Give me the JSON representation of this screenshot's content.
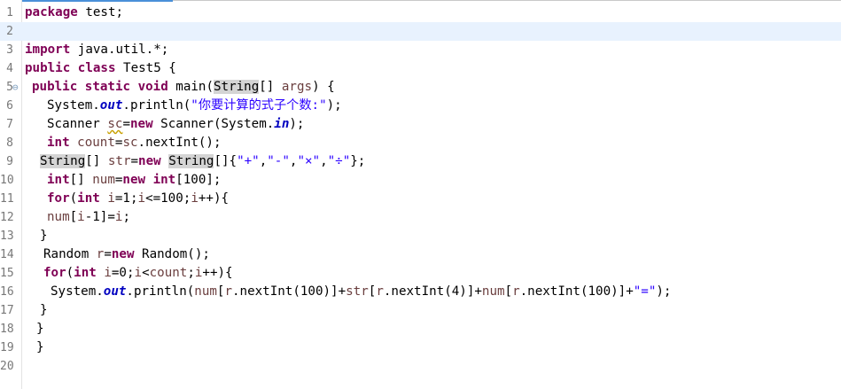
{
  "editor": {
    "current_line": 2,
    "lines": [
      {
        "n": "1",
        "fold": false,
        "indent": 0,
        "tokens": [
          {
            "t": "package",
            "c": "kw"
          },
          {
            "t": " test;",
            "c": ""
          }
        ]
      },
      {
        "n": "2",
        "fold": false,
        "indent": 0,
        "tokens": []
      },
      {
        "n": "3",
        "fold": false,
        "indent": 0,
        "tokens": [
          {
            "t": "import",
            "c": "kw"
          },
          {
            "t": " java.util.*;",
            "c": ""
          }
        ]
      },
      {
        "n": "4",
        "fold": false,
        "indent": 0,
        "tokens": [
          {
            "t": "public",
            "c": "kw"
          },
          {
            "t": " ",
            "c": ""
          },
          {
            "t": "class",
            "c": "kw"
          },
          {
            "t": " Test5 {",
            "c": ""
          }
        ]
      },
      {
        "n": "5",
        "fold": true,
        "indent": 2,
        "tokens": [
          {
            "t": "public",
            "c": "kw"
          },
          {
            "t": " ",
            "c": ""
          },
          {
            "t": "static",
            "c": "kw"
          },
          {
            "t": " ",
            "c": ""
          },
          {
            "t": "void",
            "c": "kw"
          },
          {
            "t": " main(",
            "c": ""
          },
          {
            "t": "String",
            "c": "hl"
          },
          {
            "t": "[] ",
            "c": ""
          },
          {
            "t": "args",
            "c": "var"
          },
          {
            "t": ") {",
            "c": ""
          }
        ]
      },
      {
        "n": "6",
        "fold": false,
        "indent": 6,
        "tokens": [
          {
            "t": "System.",
            "c": ""
          },
          {
            "t": "out",
            "c": "fld"
          },
          {
            "t": ".println(",
            "c": ""
          },
          {
            "t": "\"你要计算的式子个数:\"",
            "c": "str"
          },
          {
            "t": ");",
            "c": ""
          }
        ]
      },
      {
        "n": "7",
        "fold": false,
        "indent": 6,
        "tokens": [
          {
            "t": "Scanner ",
            "c": ""
          },
          {
            "t": "sc",
            "c": "var warn"
          },
          {
            "t": "=",
            "c": ""
          },
          {
            "t": "new",
            "c": "kw"
          },
          {
            "t": " Scanner(System.",
            "c": ""
          },
          {
            "t": "in",
            "c": "fld"
          },
          {
            "t": ");",
            "c": ""
          }
        ]
      },
      {
        "n": "8",
        "fold": false,
        "indent": 6,
        "tokens": [
          {
            "t": "int",
            "c": "kw"
          },
          {
            "t": " ",
            "c": ""
          },
          {
            "t": "count",
            "c": "var"
          },
          {
            "t": "=",
            "c": ""
          },
          {
            "t": "sc",
            "c": "var"
          },
          {
            "t": ".nextInt();",
            "c": ""
          }
        ]
      },
      {
        "n": "9",
        "fold": false,
        "indent": 4,
        "tokens": [
          {
            "t": "String",
            "c": "hl"
          },
          {
            "t": "[] ",
            "c": ""
          },
          {
            "t": "str",
            "c": "var"
          },
          {
            "t": "=",
            "c": ""
          },
          {
            "t": "new",
            "c": "kw"
          },
          {
            "t": " ",
            "c": ""
          },
          {
            "t": "String",
            "c": "hl"
          },
          {
            "t": "[]{",
            "c": ""
          },
          {
            "t": "\"+\"",
            "c": "str"
          },
          {
            "t": ",",
            "c": ""
          },
          {
            "t": "\"-\"",
            "c": "str"
          },
          {
            "t": ",",
            "c": ""
          },
          {
            "t": "\"×\"",
            "c": "str"
          },
          {
            "t": ",",
            "c": ""
          },
          {
            "t": "\"÷\"",
            "c": "str"
          },
          {
            "t": "};",
            "c": ""
          }
        ]
      },
      {
        "n": "10",
        "fold": false,
        "indent": 6,
        "tokens": [
          {
            "t": "int",
            "c": "kw"
          },
          {
            "t": "[] ",
            "c": ""
          },
          {
            "t": "num",
            "c": "var"
          },
          {
            "t": "=",
            "c": ""
          },
          {
            "t": "new",
            "c": "kw"
          },
          {
            "t": " ",
            "c": ""
          },
          {
            "t": "int",
            "c": "kw"
          },
          {
            "t": "[100];",
            "c": ""
          }
        ]
      },
      {
        "n": "11",
        "fold": false,
        "indent": 6,
        "tokens": [
          {
            "t": "for",
            "c": "kw"
          },
          {
            "t": "(",
            "c": ""
          },
          {
            "t": "int",
            "c": "kw"
          },
          {
            "t": " ",
            "c": ""
          },
          {
            "t": "i",
            "c": "var"
          },
          {
            "t": "=1;",
            "c": ""
          },
          {
            "t": "i",
            "c": "var"
          },
          {
            "t": "<=100;",
            "c": ""
          },
          {
            "t": "i",
            "c": "var"
          },
          {
            "t": "++){",
            "c": ""
          }
        ]
      },
      {
        "n": "12",
        "fold": false,
        "indent": 6,
        "tokens": [
          {
            "t": "num",
            "c": "var"
          },
          {
            "t": "[",
            "c": ""
          },
          {
            "t": "i",
            "c": "var"
          },
          {
            "t": "-1]=",
            "c": ""
          },
          {
            "t": "i",
            "c": "var"
          },
          {
            "t": ";",
            "c": ""
          }
        ]
      },
      {
        "n": "13",
        "fold": false,
        "indent": 4,
        "tokens": [
          {
            "t": "}",
            "c": ""
          }
        ]
      },
      {
        "n": "14",
        "fold": false,
        "indent": 5,
        "tokens": [
          {
            "t": "Random ",
            "c": ""
          },
          {
            "t": "r",
            "c": "var"
          },
          {
            "t": "=",
            "c": ""
          },
          {
            "t": "new",
            "c": "kw"
          },
          {
            "t": " Random();",
            "c": ""
          }
        ]
      },
      {
        "n": "15",
        "fold": false,
        "indent": 5,
        "tokens": [
          {
            "t": "for",
            "c": "kw"
          },
          {
            "t": "(",
            "c": ""
          },
          {
            "t": "int",
            "c": "kw"
          },
          {
            "t": " ",
            "c": ""
          },
          {
            "t": "i",
            "c": "var"
          },
          {
            "t": "=0;",
            "c": ""
          },
          {
            "t": "i",
            "c": "var"
          },
          {
            "t": "<",
            "c": ""
          },
          {
            "t": "count",
            "c": "var"
          },
          {
            "t": ";",
            "c": ""
          },
          {
            "t": "i",
            "c": "var"
          },
          {
            "t": "++){",
            "c": ""
          }
        ]
      },
      {
        "n": "16",
        "fold": false,
        "indent": 7,
        "tokens": [
          {
            "t": "System.",
            "c": ""
          },
          {
            "t": "out",
            "c": "fld"
          },
          {
            "t": ".println(",
            "c": ""
          },
          {
            "t": "num",
            "c": "var"
          },
          {
            "t": "[",
            "c": ""
          },
          {
            "t": "r",
            "c": "var"
          },
          {
            "t": ".nextInt(100)]+",
            "c": ""
          },
          {
            "t": "str",
            "c": "var"
          },
          {
            "t": "[",
            "c": ""
          },
          {
            "t": "r",
            "c": "var"
          },
          {
            "t": ".nextInt(4)]+",
            "c": ""
          },
          {
            "t": "num",
            "c": "var"
          },
          {
            "t": "[",
            "c": ""
          },
          {
            "t": "r",
            "c": "var"
          },
          {
            "t": ".nextInt(100)]+",
            "c": ""
          },
          {
            "t": "\"=\"",
            "c": "str"
          },
          {
            "t": ");",
            "c": ""
          }
        ]
      },
      {
        "n": "17",
        "fold": false,
        "indent": 4,
        "tokens": [
          {
            "t": "}",
            "c": ""
          }
        ]
      },
      {
        "n": "18",
        "fold": false,
        "indent": 3,
        "tokens": [
          {
            "t": "}",
            "c": ""
          }
        ]
      },
      {
        "n": "19",
        "fold": false,
        "indent": 3,
        "tokens": [
          {
            "t": "}",
            "c": ""
          }
        ]
      },
      {
        "n": "20",
        "fold": false,
        "indent": 0,
        "tokens": []
      }
    ]
  },
  "icons": {
    "fold_glyph": "⊖"
  }
}
